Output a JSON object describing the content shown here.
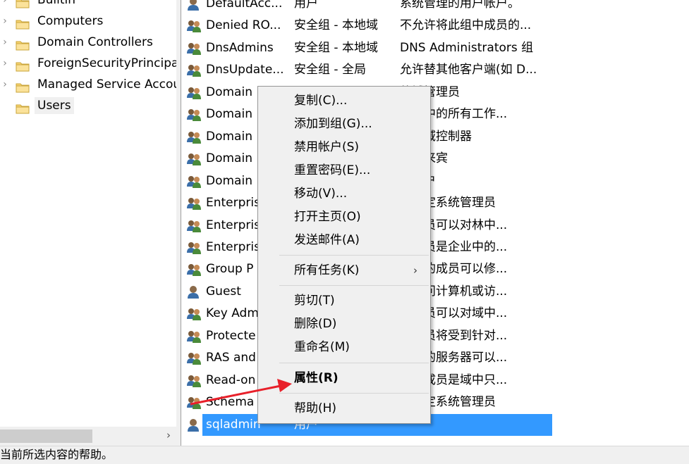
{
  "tree": {
    "items": [
      {
        "label": "Builtin",
        "expandable": true
      },
      {
        "label": "Computers",
        "expandable": true
      },
      {
        "label": "Domain Controllers",
        "expandable": true
      },
      {
        "label": "ForeignSecurityPrincipals",
        "expandable": true
      },
      {
        "label": "Managed Service Accounts",
        "expandable": true
      },
      {
        "label": "Users",
        "expandable": false,
        "selected": true
      }
    ],
    "scroll_right_glyph": "›"
  },
  "list": {
    "rows": [
      {
        "name": "DefaultAcc...",
        "type": "用户",
        "desc": "系统管理的用户帐户。",
        "icon": "user-icon"
      },
      {
        "name": "Denied RO...",
        "type": "安全组 - 本地域",
        "desc": "不允许将此组中成员的...",
        "icon": "group-icon"
      },
      {
        "name": "DnsAdmins",
        "type": "安全组 - 本地域",
        "desc": "DNS Administrators 组",
        "icon": "group-icon"
      },
      {
        "name": "DnsUpdate...",
        "type": "安全组 - 全局",
        "desc": "允许替其他客户端(如 D...",
        "icon": "group-icon"
      },
      {
        "name": "Domain",
        "type": "",
        "desc": "的域管理员",
        "icon": "group-icon"
      },
      {
        "name": "Domain",
        "type": "",
        "desc": "则域中的所有工作...",
        "icon": "group-icon"
      },
      {
        "name": "Domain",
        "type": "",
        "desc": "所有域控制器",
        "icon": "group-icon"
      },
      {
        "name": "Domain",
        "type": "",
        "desc": "所有来宾",
        "icon": "group-icon"
      },
      {
        "name": "Domain",
        "type": "",
        "desc": "或用户",
        "icon": "group-icon"
      },
      {
        "name": "Enterpris",
        "type": "",
        "desc": "的指定系统管理员",
        "icon": "group-icon"
      },
      {
        "name": "Enterpris",
        "type": "",
        "desc": "的成员可以对林中...",
        "icon": "group-icon"
      },
      {
        "name": "Enterpris",
        "type": "",
        "desc": "的成员是企业中的...",
        "icon": "group-icon"
      },
      {
        "name": "Group P",
        "type": "",
        "desc": "组中的成员可以修...",
        "icon": "group-icon"
      },
      {
        "name": "Guest",
        "type": "",
        "desc": "宾访问计算机或访...",
        "icon": "user-icon"
      },
      {
        "name": "Key Adm",
        "type": "",
        "desc": "的成员可以对域中...",
        "icon": "group-icon"
      },
      {
        "name": "Protecte",
        "type": "",
        "desc": "的成员将受到针对...",
        "icon": "group-icon"
      },
      {
        "name": "RAS and",
        "type": "",
        "desc": "组中的服务器可以...",
        "icon": "group-icon"
      },
      {
        "name": "Read-on",
        "type": "",
        "desc": "中的成员是域中只...",
        "icon": "group-icon"
      },
      {
        "name": "Schema",
        "type": "",
        "desc": "的指定系统管理员",
        "icon": "group-icon"
      },
      {
        "name": "sqladmin",
        "type": "用户",
        "desc": "",
        "icon": "user-icon",
        "selected": true
      }
    ]
  },
  "context_menu": {
    "items": [
      {
        "label": "复制(C)..."
      },
      {
        "label": "添加到组(G)..."
      },
      {
        "label": "禁用帐户(S)"
      },
      {
        "label": "重置密码(E)..."
      },
      {
        "label": "移动(V)..."
      },
      {
        "label": "打开主页(O)"
      },
      {
        "label": "发送邮件(A)"
      },
      {
        "label": "所有任务(K)",
        "submenu": true
      },
      {
        "label": "剪切(T)"
      },
      {
        "label": "删除(D)"
      },
      {
        "label": "重命名(M)"
      },
      {
        "label": "属性(R)",
        "bold": true
      },
      {
        "label": "帮助(H)"
      }
    ],
    "submenu_glyph": "›"
  },
  "statusbar": {
    "text": "当前所选内容的帮助。"
  },
  "colors": {
    "selection": "#3399ff",
    "annotation_arrow": "#e8202a"
  }
}
